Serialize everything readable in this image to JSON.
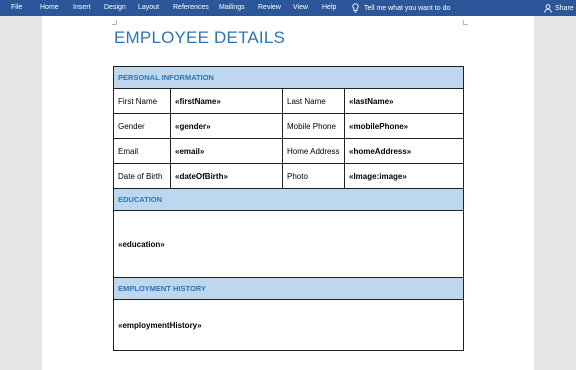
{
  "ribbon": {
    "menu": [
      {
        "name": "menu-file",
        "label": "File"
      },
      {
        "name": "menu-home",
        "label": "Home"
      },
      {
        "name": "menu-insert",
        "label": "Insert"
      },
      {
        "name": "menu-design",
        "label": "Design"
      },
      {
        "name": "menu-layout",
        "label": "Layout"
      },
      {
        "name": "menu-references",
        "label": "References"
      },
      {
        "name": "menu-mailings",
        "label": "Mailings"
      },
      {
        "name": "menu-review",
        "label": "Review"
      },
      {
        "name": "menu-view",
        "label": "View"
      },
      {
        "name": "menu-help",
        "label": "Help"
      }
    ],
    "tell_me": "Tell me what you want to do",
    "share": "Share",
    "colors": {
      "ribbon_bg": "#2b579a",
      "text": "#ffffff"
    },
    "icons": {
      "tell_me": "lightbulb-icon",
      "share": "person-icon"
    }
  },
  "document": {
    "title": "EMPLOYEE DETAILS",
    "colors": {
      "heading": "#2e74b5",
      "section_bg": "#bdd7ee"
    },
    "sections": {
      "personal": "PERSONAL INFORMATION",
      "education": "EDUCATION",
      "employment": "EMPLOYMENT HISTORY"
    },
    "personal_rows": [
      {
        "label1": "First Name",
        "field1": "«firstName»",
        "label2": "Last Name",
        "field2": "«lastName»"
      },
      {
        "label1": "Gender",
        "field1": "«gender»",
        "label2": "Mobile Phone",
        "field2": "«mobilePhone»"
      },
      {
        "label1": "Email",
        "field1": "«email»",
        "label2": "Home Address",
        "field2": "«homeAddress»"
      },
      {
        "label1": "Date of Birth",
        "field1": "«dateOfBirth»",
        "label2": "Photo",
        "field2": "«Image:image»"
      }
    ],
    "education_field": "«education»",
    "employment_field": "«employmentHistory»"
  }
}
